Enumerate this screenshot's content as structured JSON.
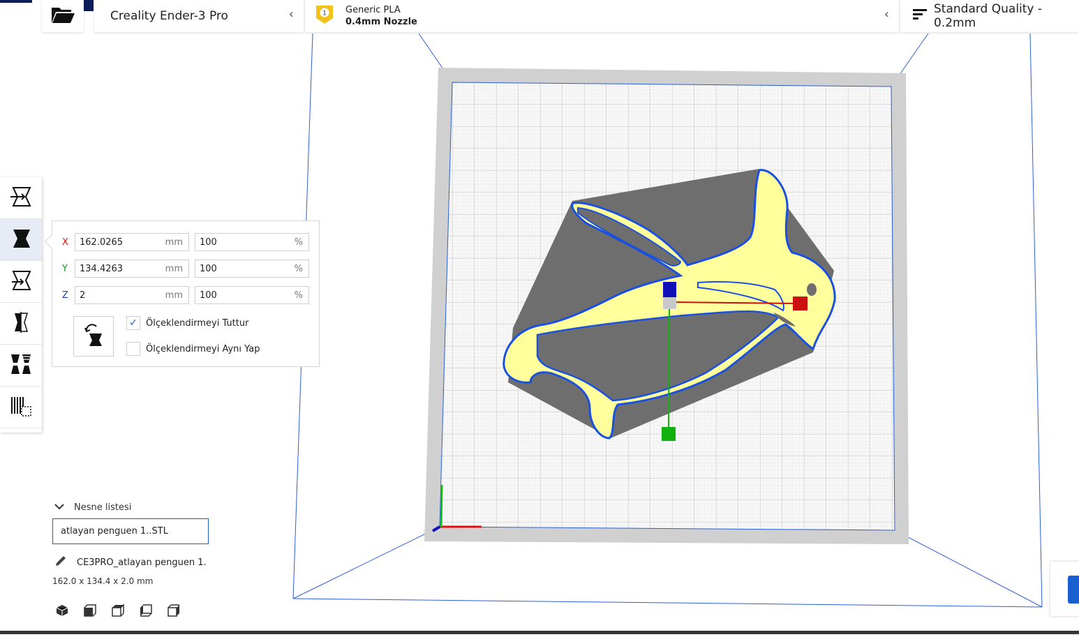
{
  "printer": {
    "name": "Creality Ender-3 Pro"
  },
  "material": {
    "extruder_number": "1",
    "name": "Generic PLA",
    "nozzle": "0.4mm Nozzle"
  },
  "quality": {
    "label": "Standard Quality - 0.2mm"
  },
  "scale_tool": {
    "x": {
      "label": "X",
      "mm": "162.0265",
      "unit": "mm",
      "percent": "100",
      "pct_unit": "%"
    },
    "y": {
      "label": "Y",
      "mm": "134.4263",
      "unit": "mm",
      "percent": "100",
      "pct_unit": "%"
    },
    "z": {
      "label": "Z",
      "mm": "2",
      "unit": "mm",
      "percent": "100",
      "pct_unit": "%"
    },
    "snap_scaling": {
      "label": "Ölçeklendirmeyi Tuttur",
      "checked": true
    },
    "uniform_scaling": {
      "label": "Ölçeklendirmeyi Aynı Yap",
      "checked": false
    }
  },
  "object_list": {
    "header": "Nesne listesi",
    "selected": "atlayan penguen 1..STL",
    "job_name": "CE3PRO_atlayan penguen 1.",
    "dimensions": "162.0 x 134.4 x 2.0 mm"
  },
  "colors": {
    "accent": "#1a5fd0",
    "dark": "#0c1e5a",
    "model_fill": "#ffff9c",
    "axis_x": "#e01010",
    "axis_y": "#10c010",
    "axis_z": "#1010c0"
  }
}
